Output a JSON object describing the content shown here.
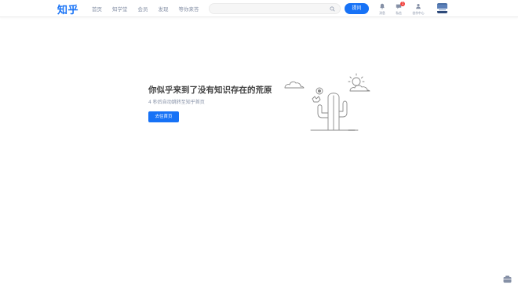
{
  "header": {
    "logo": "知乎",
    "nav": [
      {
        "label": "首页"
      },
      {
        "label": "知学堂"
      },
      {
        "label": "会员"
      },
      {
        "label": "发现"
      },
      {
        "label": "等你来答"
      }
    ],
    "search": {
      "placeholder": "",
      "icon": "search-icon"
    },
    "ask_label": "提问",
    "tools": [
      {
        "label": "消息",
        "icon": "bell-icon"
      },
      {
        "label": "私信",
        "icon": "message-icon",
        "badge": "1"
      },
      {
        "label": "创作中心",
        "icon": "creator-icon"
      }
    ]
  },
  "error": {
    "title": "你似乎来到了没有知识存在的荒原",
    "subtitle": "4 秒后自动跳转至知乎首页",
    "button": "去往首页"
  },
  "colors": {
    "brand": "#1772f6",
    "muted": "#8590a6",
    "badge": "#f1403c"
  }
}
